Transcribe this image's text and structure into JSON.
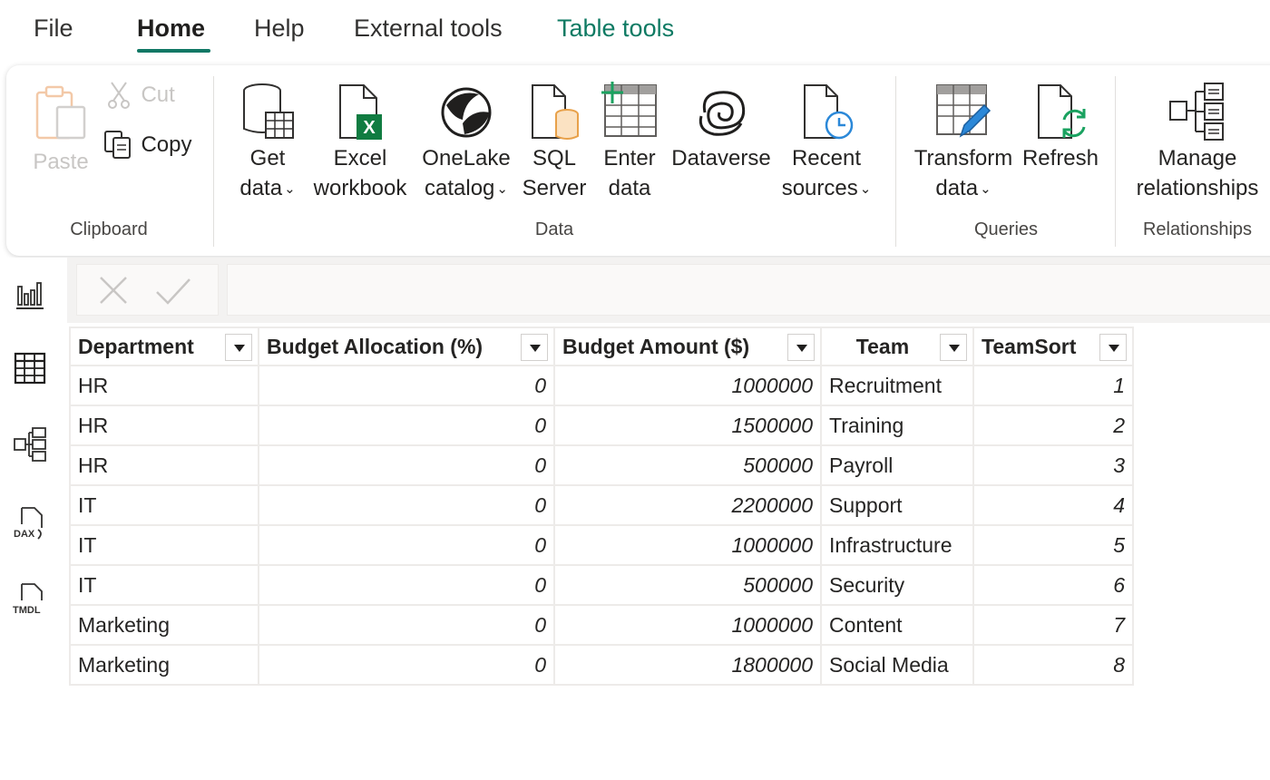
{
  "menu": {
    "tabs": [
      "File",
      "Home",
      "Help",
      "External tools",
      "Table tools"
    ],
    "active": "Home"
  },
  "ribbon": {
    "clipboard": {
      "paste": "Paste",
      "cut": "Cut",
      "copy": "Copy",
      "group_label": "Clipboard"
    },
    "data": {
      "get_data": [
        "Get",
        "data"
      ],
      "excel": [
        "Excel",
        "workbook"
      ],
      "onelake": [
        "OneLake",
        "catalog"
      ],
      "sql": [
        "SQL",
        "Server"
      ],
      "enter": [
        "Enter",
        "data"
      ],
      "dataverse": "Dataverse",
      "recent": [
        "Recent",
        "sources"
      ],
      "group_label": "Data"
    },
    "queries": {
      "transform": [
        "Transform",
        "data"
      ],
      "refresh": "Refresh",
      "group_label": "Queries"
    },
    "relationships": {
      "manage": [
        "Manage",
        "relationships"
      ],
      "group_label": "Relationships"
    }
  },
  "left_rail": [
    "report-view-icon",
    "table-view-icon",
    "model-view-icon",
    "dax-query-view-icon",
    "tmdl-view-icon"
  ],
  "table": {
    "columns": [
      "Department",
      "Budget Allocation (%)",
      "Budget Amount ($)",
      "Team",
      "TeamSort"
    ],
    "rows": [
      [
        "HR",
        "0",
        "1000000",
        "Recruitment",
        "1"
      ],
      [
        "HR",
        "0",
        "1500000",
        "Training",
        "2"
      ],
      [
        "HR",
        "0",
        "500000",
        "Payroll",
        "3"
      ],
      [
        "IT",
        "0",
        "2200000",
        "Support",
        "4"
      ],
      [
        "IT",
        "0",
        "1000000",
        "Infrastructure",
        "5"
      ],
      [
        "IT",
        "0",
        "500000",
        "Security",
        "6"
      ],
      [
        "Marketing",
        "0",
        "1000000",
        "Content",
        "7"
      ],
      [
        "Marketing",
        "0",
        "1800000",
        "Social Media",
        "8"
      ]
    ]
  },
  "colors": {
    "accent": "#117865",
    "table_tools": "#0e7a63",
    "excel_green": "#107c41",
    "sql_orange": "#e8a14a",
    "refresh_green": "#1aa260",
    "pencil_blue": "#2b88d8"
  }
}
